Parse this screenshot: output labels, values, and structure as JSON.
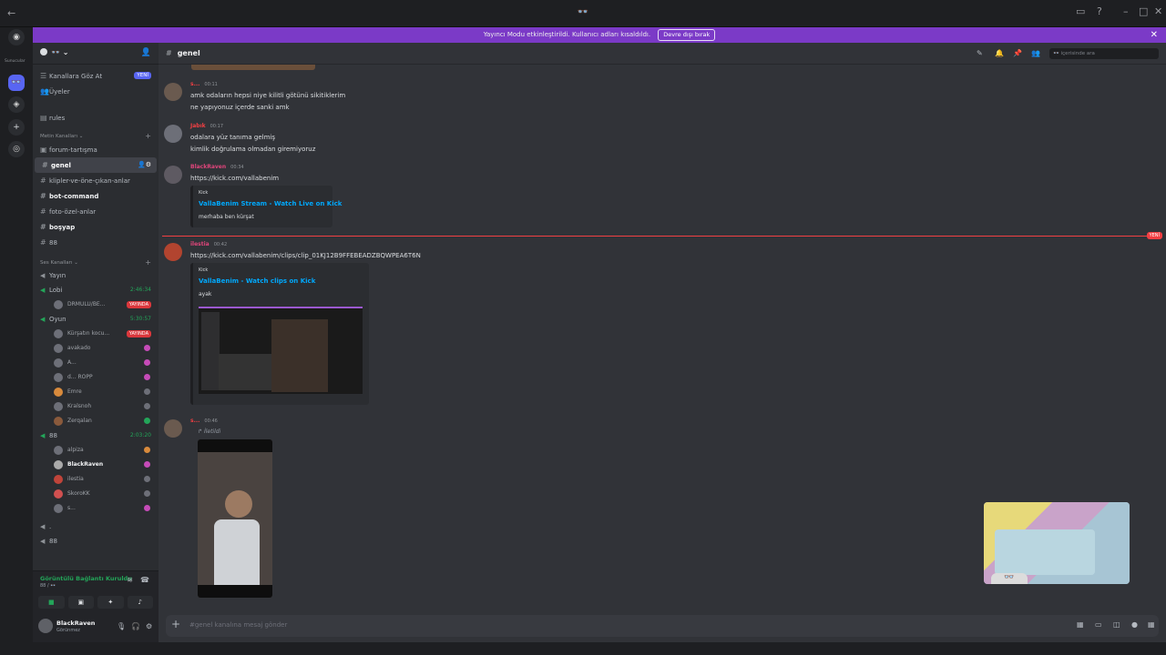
{
  "titlebar": {
    "title": "👓",
    "back": "←"
  },
  "banner": {
    "text": "Yayıncı Modu etkinleştirildi. Kullanıcı adları kısaldıldı.",
    "button": "Devre dışı bırak"
  },
  "rail": {
    "label": "Sunucular"
  },
  "server": {
    "name": "👓"
  },
  "sidebar": {
    "top_items": [
      {
        "label": "Kanallara Göz At",
        "badge": "YENİ"
      },
      {
        "label": "Üyeler"
      }
    ],
    "rules": "rules",
    "text_category": "Metin Kanalları",
    "text_channels": [
      {
        "label": "forum-tartışma"
      },
      {
        "label": "genel"
      },
      {
        "label": "klipler-ve-öne-çıkan-anlar"
      },
      {
        "label": "bot-command"
      },
      {
        "label": "foto-özel-anlar"
      },
      {
        "label": "boşyap"
      },
      {
        "label": "88"
      }
    ],
    "voice_category": "Ses Kanalları",
    "voice": {
      "yayin": "Yayın",
      "lobi": {
        "name": "Lobi",
        "time": "2:46:34",
        "users": [
          {
            "name": "DRMULU/BE...",
            "live": "YAYINDA"
          }
        ]
      },
      "oyun": {
        "name": "Oyun",
        "time": "5:30:57",
        "users": [
          {
            "name": "Kürşatın kocu...",
            "live": "YAYINDA"
          },
          {
            "name": "avakado"
          },
          {
            "name": "A..."
          },
          {
            "name": "d... ROPP"
          },
          {
            "name": "Emre"
          },
          {
            "name": "Kralsnoh"
          },
          {
            "name": "Zerqalan"
          }
        ]
      },
      "b88": {
        "name": "88",
        "time": "2:03:20",
        "users": [
          {
            "name": "alpiza"
          },
          {
            "name": "BlackRaven"
          },
          {
            "name": "ilestia"
          },
          {
            "name": "SkoroKK"
          },
          {
            "name": "s..."
          }
        ]
      },
      "extra": [
        {
          "name": "."
        },
        {
          "name": "88"
        }
      ]
    }
  },
  "voice_panel": {
    "status": "Görüntülü Bağlantı Kuruldu",
    "sub": "88 / 👓"
  },
  "user": {
    "name": "BlackRaven",
    "status": "Görünmez"
  },
  "channel": {
    "name": "genel",
    "search_placeholder": "👓 içerisinde ara"
  },
  "messages": [
    {
      "author": "s...",
      "time": "00:11",
      "lines": [
        "amk odaların hepsi niye kilitli götünü sikitiklerim",
        "ne yapıyonuz içerde sanki amk"
      ]
    },
    {
      "author": "Jabık",
      "time": "00:17",
      "lines": [
        "odalara yüz tanıma gelmiş",
        "kimlik doğrulama olmadan giremiyoruz"
      ]
    },
    {
      "author": "BlackRaven",
      "time": "00:34",
      "link": "https://kick.com/vallabenim",
      "embed": {
        "provider": "Kick",
        "title": "VallaBenim Stream - Watch Live on Kick",
        "desc": "merhaba ben kürşat"
      }
    },
    {
      "author": "ilestia",
      "time": "00:42",
      "link": "https://kick.com/vallabenim/clips/clip_01KJ12B9FFEBEADZBQWPEA6T6N",
      "embed": {
        "provider": "Kick",
        "title": "VallaBenim - Watch clips on Kick",
        "desc": "ayak"
      }
    },
    {
      "author": "s...",
      "time": "00:46",
      "forwarded": "İletildi"
    }
  ],
  "divider": {
    "label": "YENİ"
  },
  "composer": {
    "placeholder": "#genel kanalına mesaj gönder"
  },
  "colors": {
    "accent": "#7b3ac7",
    "link": "#00a8fc",
    "online": "#23a559",
    "danger": "#f23f43"
  }
}
